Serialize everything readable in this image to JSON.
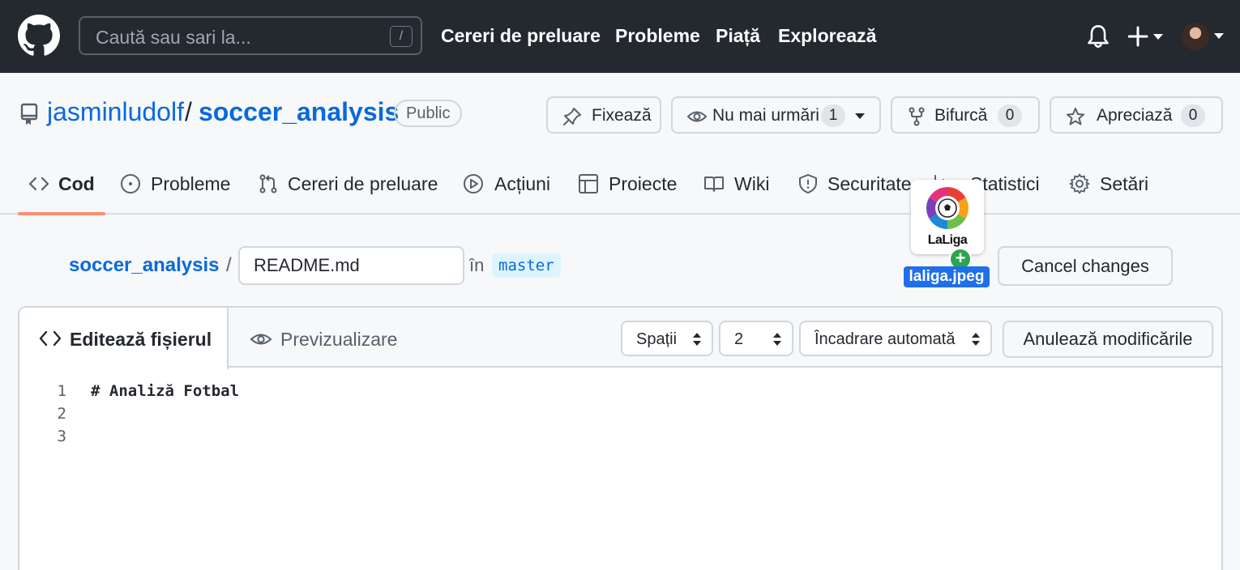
{
  "header": {
    "search_placeholder": "Caută sau sari la...",
    "search_shortcut": "/",
    "nav": [
      "Cereri de preluare",
      "Probleme",
      "Piață",
      "Explorează"
    ]
  },
  "repo": {
    "owner": "jasminludolf",
    "separator": "/",
    "name": "soccer_analysis",
    "visibility": "Public",
    "actions": {
      "pin_label": "Fixează",
      "watch_label": "Nu mai urmări",
      "watch_count": "1",
      "fork_label": "Bifurcă",
      "fork_count": "0",
      "star_label": "Apreciază",
      "star_count": "0"
    },
    "tabs": [
      {
        "label": "Cod",
        "icon": "code-icon",
        "active": true
      },
      {
        "label": "Probleme",
        "icon": "issue-icon"
      },
      {
        "label": "Cereri de preluare",
        "icon": "pull-request-icon"
      },
      {
        "label": "Acțiuni",
        "icon": "play-icon"
      },
      {
        "label": "Proiecte",
        "icon": "table-icon"
      },
      {
        "label": "Wiki",
        "icon": "book-icon"
      },
      {
        "label": "Securitate",
        "icon": "shield-icon"
      },
      {
        "label": "Statistici",
        "icon": "graph-icon"
      },
      {
        "label": "Setări",
        "icon": "gear-icon"
      }
    ]
  },
  "editor_path": {
    "repo_link": "soccer_analysis",
    "separator": "/",
    "filename": "README.md",
    "in_label": "în",
    "branch": "master",
    "cancel_label": "Cancel changes"
  },
  "drag_file": {
    "logo_text": "LaLiga",
    "filename": "laliga.jpeg"
  },
  "editor": {
    "edit_tab_label": "Editează fișierul",
    "preview_tab_label": "Previzualizare",
    "indent_mode": "Spații",
    "indent_size": "2",
    "wrap_mode": "Încadrare automată",
    "cancel_label": "Anulează modificările",
    "line_numbers": [
      "1",
      "2",
      "3"
    ],
    "lines": [
      "# Analiză Fotbal",
      "",
      ""
    ]
  },
  "colors": {
    "header_bg": "#24292f",
    "link": "#0969da",
    "active_tab_underline": "#fd8c73",
    "drag_label_bg": "#1f6feb"
  }
}
